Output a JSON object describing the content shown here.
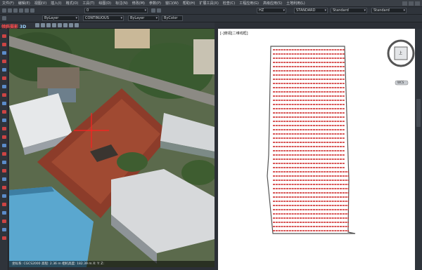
{
  "menu": {
    "items": [
      "文件(F)",
      "编辑(E)",
      "视图(V)",
      "插入(I)",
      "格式(O)",
      "工具(T)",
      "绘图(D)",
      "标注(N)",
      "修改(M)",
      "参数(P)",
      "窗口(W)",
      "帮助(H)",
      "扩展工具(X)",
      "检查(C)",
      "工程应用(G)",
      "高级应用(S)",
      "土地利用(L)"
    ]
  },
  "toolbar": {
    "layer_value": "ByLayer",
    "layer_value2": "ByLayer",
    "linetype_value": "CONTINUOUS",
    "lineweight_value": "ByLayer",
    "color_value": "ByColor",
    "scale_value": "HZ",
    "style1": "STANDARD",
    "style2": "Standard",
    "style3": "Standard",
    "layer_zero": "0"
  },
  "viewport3d": {
    "label_text": "倾斜摄影",
    "mode_text": "3D",
    "status_text": "坐标系: CGCS2000 高程: 2.36 m  相机高度: 182.39 m  X:  Y:  Z:"
  },
  "cad": {
    "label_text": "[-]俯视[二维线框]",
    "compass_label": "上",
    "ucs_label": "WCS"
  },
  "colors": {
    "accent_red": "#cc1f1f",
    "dark_bg": "#2b2f36"
  }
}
